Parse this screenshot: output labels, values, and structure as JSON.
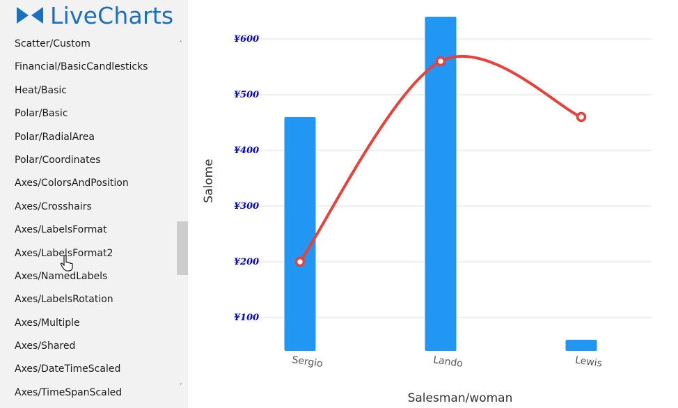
{
  "logo": {
    "text": "LiveCharts"
  },
  "sidebar": {
    "items": [
      "Scatter/Custom",
      "Financial/BasicCandlesticks",
      "Heat/Basic",
      "Polar/Basic",
      "Polar/RadialArea",
      "Polar/Coordinates",
      "Axes/ColorsAndPosition",
      "Axes/Crosshairs",
      "Axes/LabelsFormat",
      "Axes/LabelsFormat2",
      "Axes/NamedLabels",
      "Axes/LabelsRotation",
      "Axes/Multiple",
      "Axes/Shared",
      "Axes/DateTimeScaled",
      "Axes/TimeSpanScaled"
    ]
  },
  "chart_data": {
    "type": "bar",
    "categories": [
      "Sergio",
      "Lando",
      "Lewis"
    ],
    "series": [
      {
        "type": "bar",
        "values": [
          460,
          640,
          60
        ],
        "color": "#2196f3"
      },
      {
        "type": "line",
        "values": [
          200,
          560,
          460
        ],
        "color": "#e8413a",
        "smooth": true
      }
    ],
    "xlabel": "Salesman/woman",
    "ylabel": "Salome",
    "yticks": [
      100,
      200,
      300,
      400,
      500,
      600
    ],
    "ytick_labels": [
      "¥100",
      "¥200",
      "¥300",
      "¥400",
      "¥500",
      "¥600"
    ],
    "ylim": [
      40,
      640
    ],
    "grid": true
  }
}
